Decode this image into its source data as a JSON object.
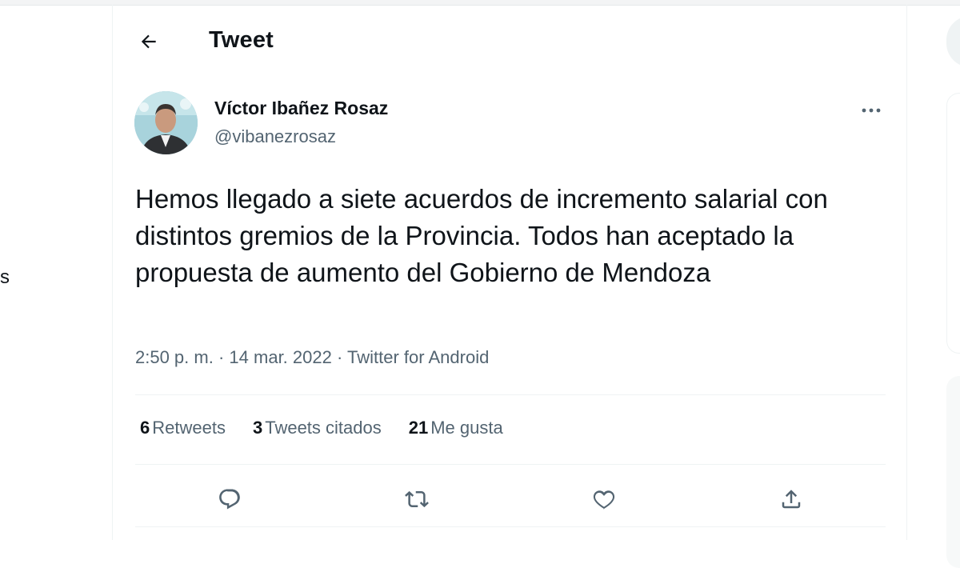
{
  "left_nav": {
    "fragment": "s"
  },
  "header": {
    "back_icon": "arrow-left-icon",
    "title": "Tweet"
  },
  "tweet": {
    "author": {
      "name": "Víctor Ibañez Rosaz",
      "handle": "@vibanezrosaz",
      "avatar_icon": "profile-photo"
    },
    "more_icon": "ellipsis-icon",
    "text": "Hemos llegado a siete acuerdos de incremento salarial con distintos gremios de la Provincia. Todos han aceptado la propuesta de aumento del Gobierno de Mendoza",
    "time": "2:50 p. m.",
    "date": "14 mar. 2022",
    "source": "Twitter for Android",
    "stats": [
      {
        "count": "6",
        "label": "Retweets"
      },
      {
        "count": "3",
        "label": "Tweets citados"
      },
      {
        "count": "21",
        "label": "Me gusta"
      }
    ],
    "actions": [
      "reply-icon",
      "retweet-icon",
      "like-icon",
      "share-icon"
    ]
  },
  "colors": {
    "text": "#0f1419",
    "secondary": "#536471",
    "divider": "#eff3f4"
  }
}
